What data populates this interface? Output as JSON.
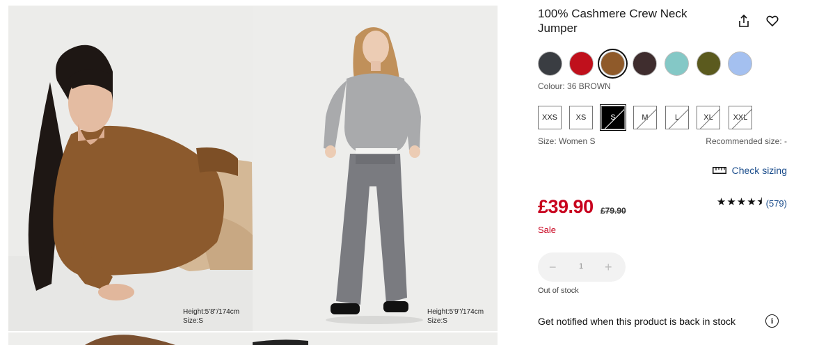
{
  "gallery": {
    "photos": [
      {
        "caption_height": "Height:5'8\"/174cm",
        "caption_size": "Size:S"
      },
      {
        "caption_height": "Height:5'9\"/174cm",
        "caption_size": "Size:S"
      }
    ]
  },
  "product": {
    "title": "100% Cashmere Crew Neck Jumper",
    "share_icon": "share-icon",
    "favorite_icon": "heart-icon"
  },
  "colours": {
    "swatches": [
      {
        "name": "dark grey",
        "hex": "#3a3d42"
      },
      {
        "name": "red",
        "hex": "#c0101c"
      },
      {
        "name": "brown",
        "hex": "#8f5a2a",
        "selected": true
      },
      {
        "name": "dark brown",
        "hex": "#3f2d2e"
      },
      {
        "name": "aqua",
        "hex": "#84c8c6"
      },
      {
        "name": "olive",
        "hex": "#5b5a1e"
      },
      {
        "name": "light blue",
        "hex": "#a4c0f0"
      }
    ],
    "label": "Colour: 36 BROWN"
  },
  "sizes": {
    "options": [
      "XXS",
      "XS",
      "S",
      "M",
      "L",
      "XL",
      "XXL"
    ],
    "selected": "S",
    "label": "Size: Women S",
    "recommended": "Recommended size: -",
    "check_sizing": "Check sizing"
  },
  "pricing": {
    "price": "£39.90",
    "old_price": "£79.90",
    "sale_label": "Sale",
    "stars": "★★★★⯨",
    "rating_value": 4.5,
    "review_count": "(579)"
  },
  "quantity": {
    "minus": "−",
    "value": "1",
    "plus": "+"
  },
  "stock": {
    "status": "Out of stock",
    "notify": "Get notified when this product is back in stock",
    "info_icon": "i"
  },
  "colors": {
    "price_red": "#c8001d",
    "link_blue": "#1a4c8b"
  }
}
